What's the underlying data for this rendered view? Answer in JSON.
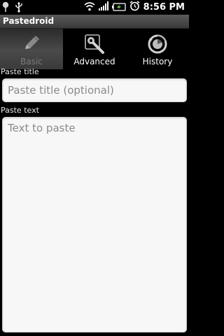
{
  "status_bar": {
    "time": "8:56 PM",
    "icons": [
      "pin-icon",
      "usb-icon",
      "wifi-icon",
      "signal-icon",
      "battery-charging-icon",
      "alarm-icon"
    ]
  },
  "app": {
    "title": "Pastedroid"
  },
  "tabs": [
    {
      "label": "Basic",
      "icon": "pencil-icon",
      "selected": true
    },
    {
      "label": "Advanced",
      "icon": "wrench-icon",
      "selected": false
    },
    {
      "label": "History",
      "icon": "history-icon",
      "selected": false
    }
  ],
  "form": {
    "title_label": "Paste title",
    "title_placeholder": "Paste title (optional)",
    "text_label": "Paste text",
    "text_placeholder": "Text to paste"
  },
  "colors": {
    "background": "#000000",
    "input_background": "#f7f7f7",
    "selected_tab_label": "#7a7a7a"
  }
}
